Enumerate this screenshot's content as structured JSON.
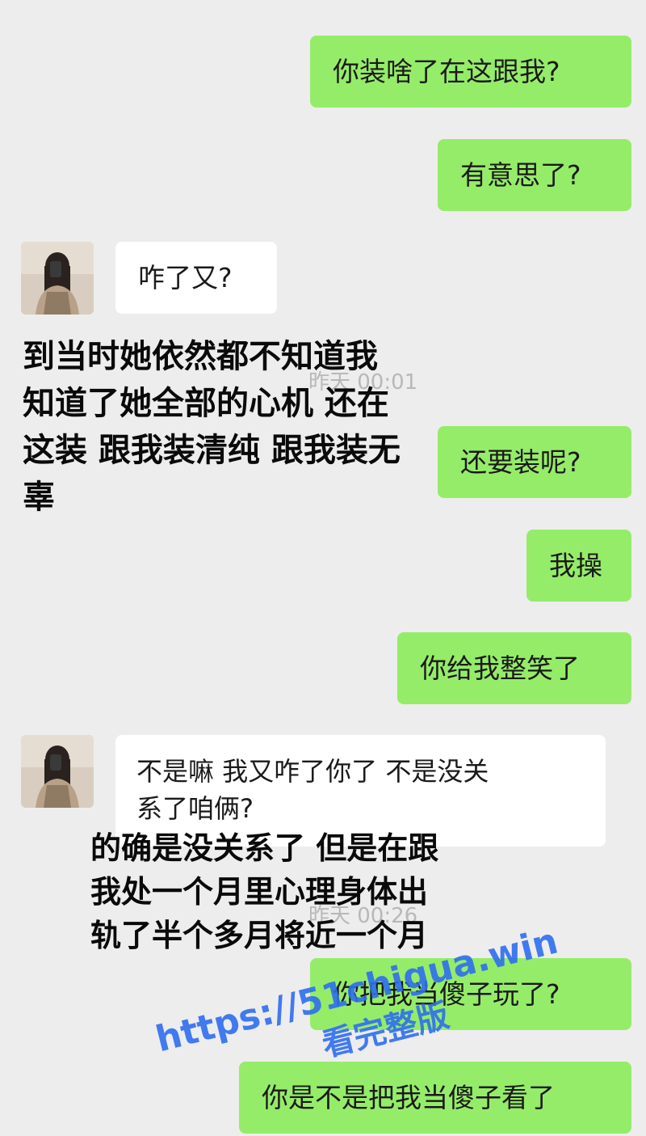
{
  "messages": {
    "m1": "你装啥了在这跟我?",
    "m2": "有意思了?",
    "m3": "咋了又?",
    "m4": "还要装呢?",
    "m5": "我操",
    "m6": "你给我整笑了",
    "m7_line1": "不是嘛  我又咋了你了  不是没关",
    "m7_line2": "系了咱俩?",
    "m8": "你把我当傻子玩了?",
    "m9": "你是不是把我当傻子看了"
  },
  "timestamps": {
    "t1": "昨天 00:01",
    "t2": "昨天 00:26"
  },
  "caption1": [
    "到当时她依然都不知道我",
    "知道了她全部的心机 还在",
    "这装 跟我装清纯 跟我装无",
    "辜"
  ],
  "caption2": [
    "的确是没关系了 但是在跟",
    "我处一个月里心理身体出",
    "轨了半个多月将近一个月"
  ],
  "watermark": {
    "url": "https://51chigua.win",
    "text": "看完整版"
  },
  "colors": {
    "self_bubble": "#95ec69",
    "other_bubble": "#ffffff",
    "background": "#ededed",
    "watermark": "#2f6ef0"
  }
}
